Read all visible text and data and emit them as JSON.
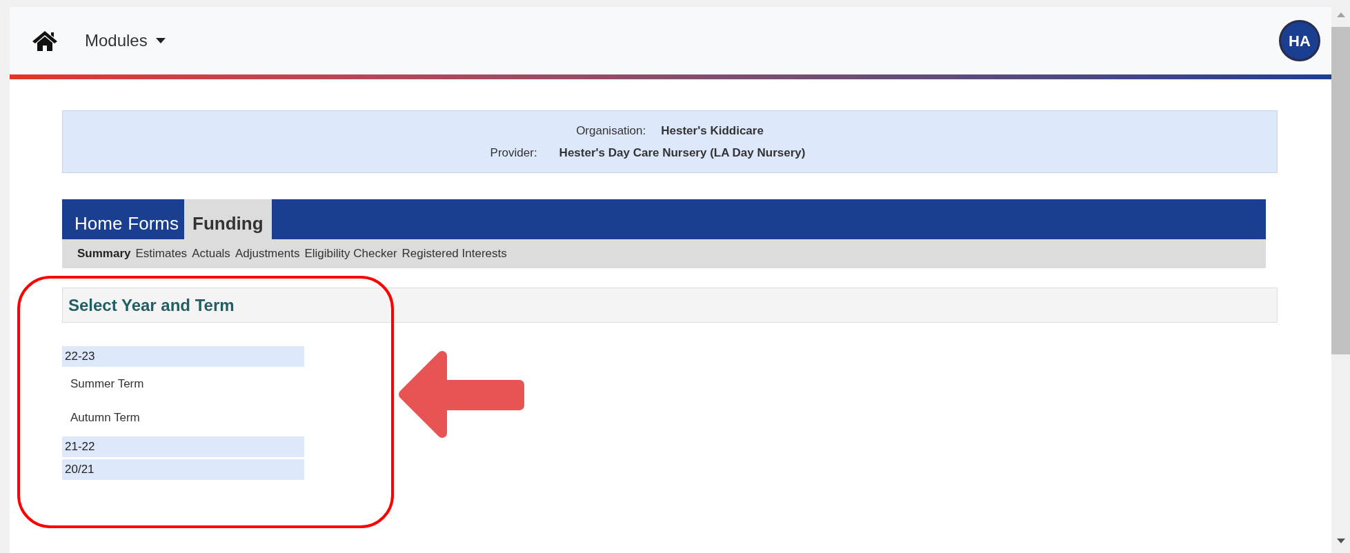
{
  "navbar": {
    "menu_label": "Modules",
    "avatar": "HA"
  },
  "organisation_info": [
    {
      "label": "Organisation:",
      "value": "Hester's Kiddicare"
    },
    {
      "label": "Provider:",
      "value": "Hester's Day Care Nursery (LA Day Nursery)"
    }
  ],
  "tabs": [
    {
      "label": "Home",
      "selected": false
    },
    {
      "label": "Forms",
      "selected": false
    },
    {
      "label": "Funding",
      "selected": true
    }
  ],
  "subtabs": [
    {
      "label": "Summary",
      "selected": true
    },
    {
      "label": "Estimates",
      "selected": false
    },
    {
      "label": "Actuals",
      "selected": false
    },
    {
      "label": "Adjustments",
      "selected": false
    },
    {
      "label": "Eligibility Checker",
      "selected": false
    },
    {
      "label": "Registered Interests",
      "selected": false
    }
  ],
  "panel": {
    "title": "Select Year and Term"
  },
  "years": [
    {
      "label": "22-23",
      "children": [
        {
          "label": "Summer Term"
        },
        {
          "label": "Autumn Term"
        }
      ]
    },
    {
      "label": "21-22"
    },
    {
      "label": "20/21"
    }
  ]
}
